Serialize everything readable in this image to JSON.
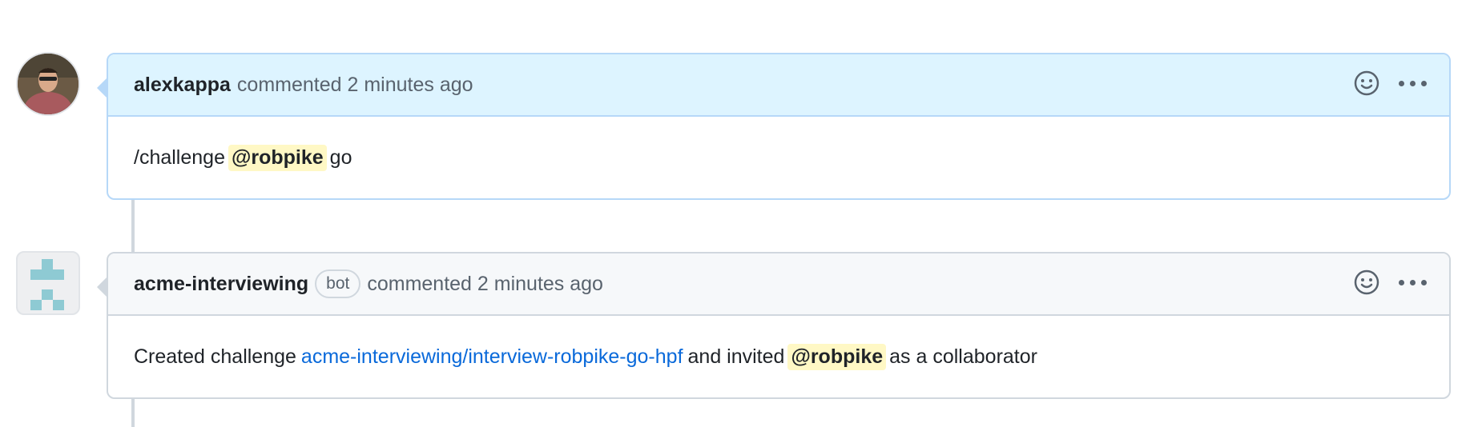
{
  "comments": [
    {
      "author": "alexkappa",
      "meta": "commented 2 minutes ago",
      "body": {
        "pre": "/challenge",
        "mention": "@robpike",
        "post": "go"
      }
    },
    {
      "author": "acme-interviewing",
      "badge": "bot",
      "meta": "commented 2 minutes ago",
      "body": {
        "pre": "Created challenge",
        "link": "acme-interviewing/interview-robpike-go-hpf",
        "mid": "and invited",
        "mention": "@robpike",
        "post": "as a collaborator"
      }
    }
  ],
  "icons": {
    "reaction": "smiley-icon",
    "more": "kebab-horizontal-icon"
  },
  "colors": {
    "link": "#0969da",
    "mention_bg": "#fff8c5",
    "highlight_header": "#ddf4ff",
    "bot_avatar": "#8ecad3"
  }
}
